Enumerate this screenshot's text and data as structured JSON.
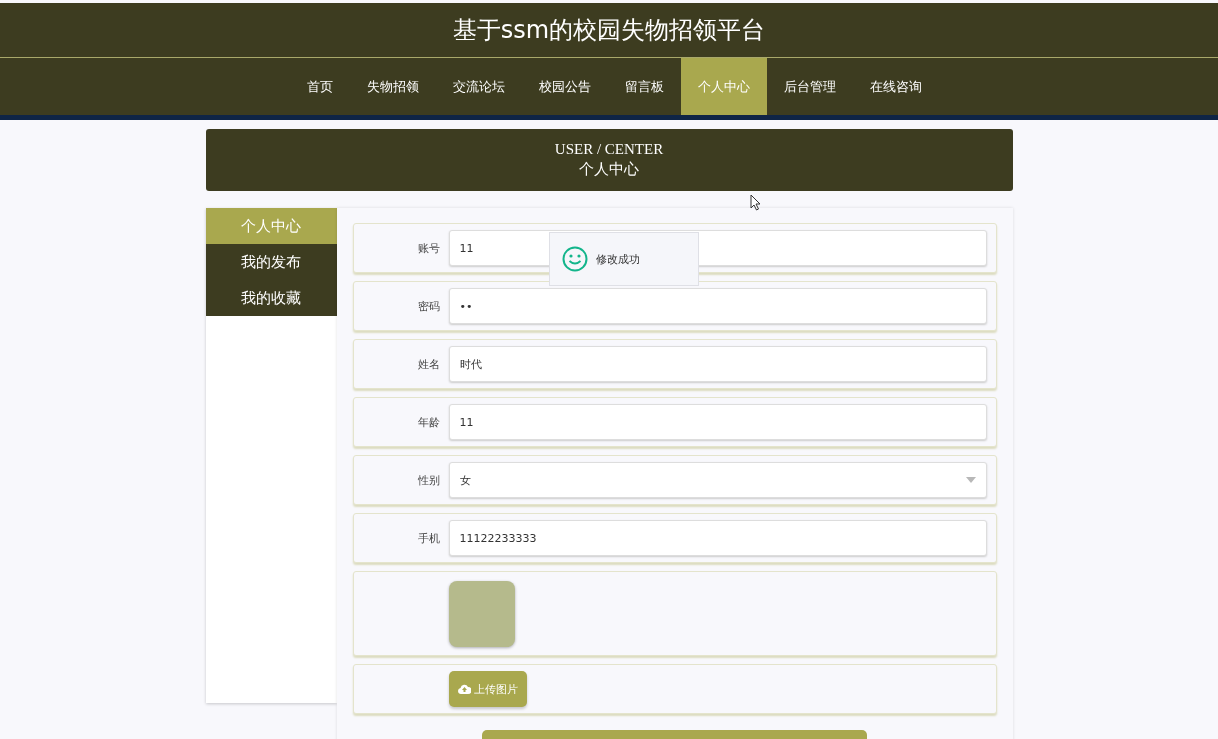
{
  "header": {
    "title": "基于ssm的校园失物招领平台"
  },
  "nav": [
    {
      "label": "首页",
      "selected": false
    },
    {
      "label": "失物招领",
      "selected": false
    },
    {
      "label": "交流论坛",
      "selected": false
    },
    {
      "label": "校园公告",
      "selected": false
    },
    {
      "label": "留言板",
      "selected": false
    },
    {
      "label": "个人中心",
      "selected": true
    },
    {
      "label": "后台管理",
      "selected": false
    },
    {
      "label": "在线咨询",
      "selected": false
    }
  ],
  "banner": {
    "title_en": "USER / CENTER",
    "title_zh": "个人中心"
  },
  "sidebar": [
    {
      "label": "个人中心",
      "selected": true
    },
    {
      "label": "我的发布",
      "selected": false
    },
    {
      "label": "我的收藏",
      "selected": false
    }
  ],
  "form": {
    "fields": [
      {
        "kind": "input",
        "label": "账号",
        "value": "11"
      },
      {
        "kind": "input",
        "label": "密码",
        "value": "••"
      },
      {
        "kind": "input",
        "label": "姓名",
        "value": "时代"
      },
      {
        "kind": "input",
        "label": "年龄",
        "value": "11"
      },
      {
        "kind": "select",
        "label": "性别",
        "value": "女"
      },
      {
        "kind": "input",
        "label": "手机",
        "value": "11122233333"
      },
      {
        "kind": "image"
      },
      {
        "kind": "upload",
        "button": "上传图片"
      }
    ]
  },
  "toast": {
    "message": "修改成功"
  }
}
